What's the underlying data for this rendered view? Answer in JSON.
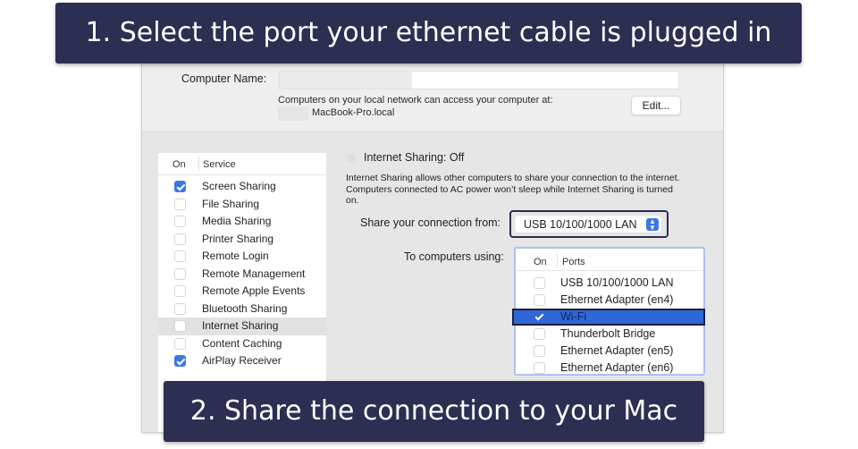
{
  "callouts": {
    "step1": "1. Select the port your ethernet cable is plugged in",
    "step2": "2. Share the connection to your Mac"
  },
  "computer_name": {
    "label": "Computer Name:",
    "value": "",
    "access_text": "Computers on your local network can access your computer at:",
    "hostname": "MacBook-Pro.local",
    "edit_button": "Edit..."
  },
  "services": {
    "header_on": "On",
    "header_service": "Service",
    "items": [
      {
        "label": "Screen Sharing",
        "checked": true,
        "selected": false
      },
      {
        "label": "File Sharing",
        "checked": false,
        "selected": false
      },
      {
        "label": "Media Sharing",
        "checked": false,
        "selected": false
      },
      {
        "label": "Printer Sharing",
        "checked": false,
        "selected": false
      },
      {
        "label": "Remote Login",
        "checked": false,
        "selected": false
      },
      {
        "label": "Remote Management",
        "checked": false,
        "selected": false
      },
      {
        "label": "Remote Apple Events",
        "checked": false,
        "selected": false
      },
      {
        "label": "Bluetooth Sharing",
        "checked": false,
        "selected": false
      },
      {
        "label": "Internet Sharing",
        "checked": false,
        "selected": true
      },
      {
        "label": "Content Caching",
        "checked": false,
        "selected": false
      },
      {
        "label": "AirPlay Receiver",
        "checked": true,
        "selected": false
      }
    ]
  },
  "internet_sharing": {
    "title": "Internet Sharing: Off",
    "description": "Internet Sharing allows other computers to share your connection to the internet. Computers connected to AC power won’t sleep while Internet Sharing is turned on.",
    "share_from_label": "Share your connection from:",
    "share_from_value": "USB 10/100/1000 LAN",
    "to_computers_label": "To computers using:",
    "ports_header_on": "On",
    "ports_header_ports": "Ports",
    "ports": [
      {
        "label": "USB 10/100/1000 LAN",
        "checked": false,
        "selected": false
      },
      {
        "label": "Ethernet Adapter (en4)",
        "checked": false,
        "selected": false
      },
      {
        "label": "Wi-Fi",
        "checked": true,
        "selected": true
      },
      {
        "label": "Thunderbolt Bridge",
        "checked": false,
        "selected": false
      },
      {
        "label": "Ethernet Adapter (en5)",
        "checked": false,
        "selected": false
      },
      {
        "label": "Ethernet Adapter (en6)",
        "checked": false,
        "selected": false
      }
    ]
  },
  "colors": {
    "callout_bg": "#2c2e52",
    "accent_blue": "#3b78e7",
    "selected_row": "#2f67d6"
  }
}
